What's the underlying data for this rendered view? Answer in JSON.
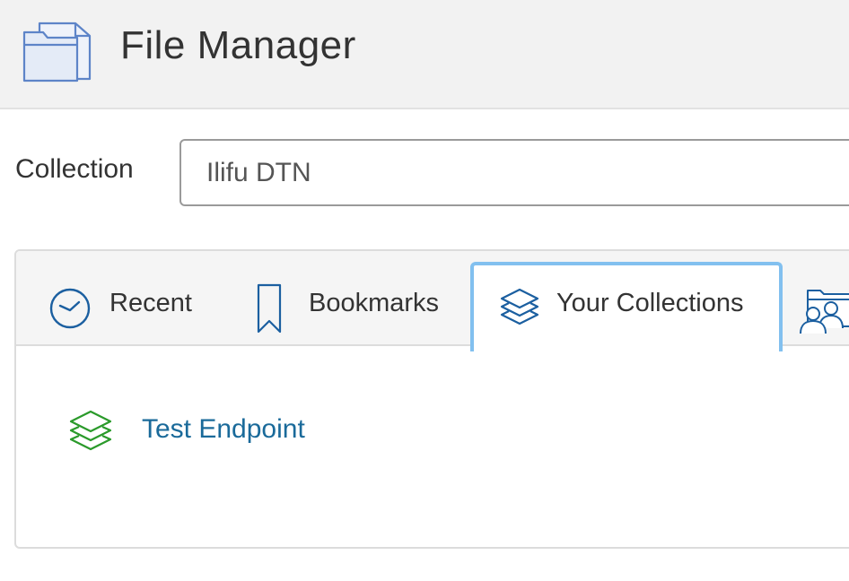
{
  "app": {
    "title": "File Manager",
    "icon": "folder-icon"
  },
  "collection": {
    "label": "Collection",
    "value": "Ilifu DTN"
  },
  "tabs": [
    {
      "label": "Recent",
      "icon": "clock-icon"
    },
    {
      "label": "Bookmarks",
      "icon": "bookmark-icon"
    },
    {
      "label": "Your Collections",
      "icon": "layers-icon",
      "active": true
    },
    {
      "label": "",
      "icon": "shared-users-icon"
    }
  ],
  "collections_list": [
    {
      "label": "Test Endpoint",
      "icon": "layers-icon",
      "icon_color": "#2a9a2a"
    }
  ],
  "colors": {
    "header_bg": "#f2f2f2",
    "link": "#1a6a9a",
    "icon_blue": "#1b5fa0",
    "active_tab_border": "#82c0ef",
    "endpoint_icon_green": "#2a9a2a"
  }
}
